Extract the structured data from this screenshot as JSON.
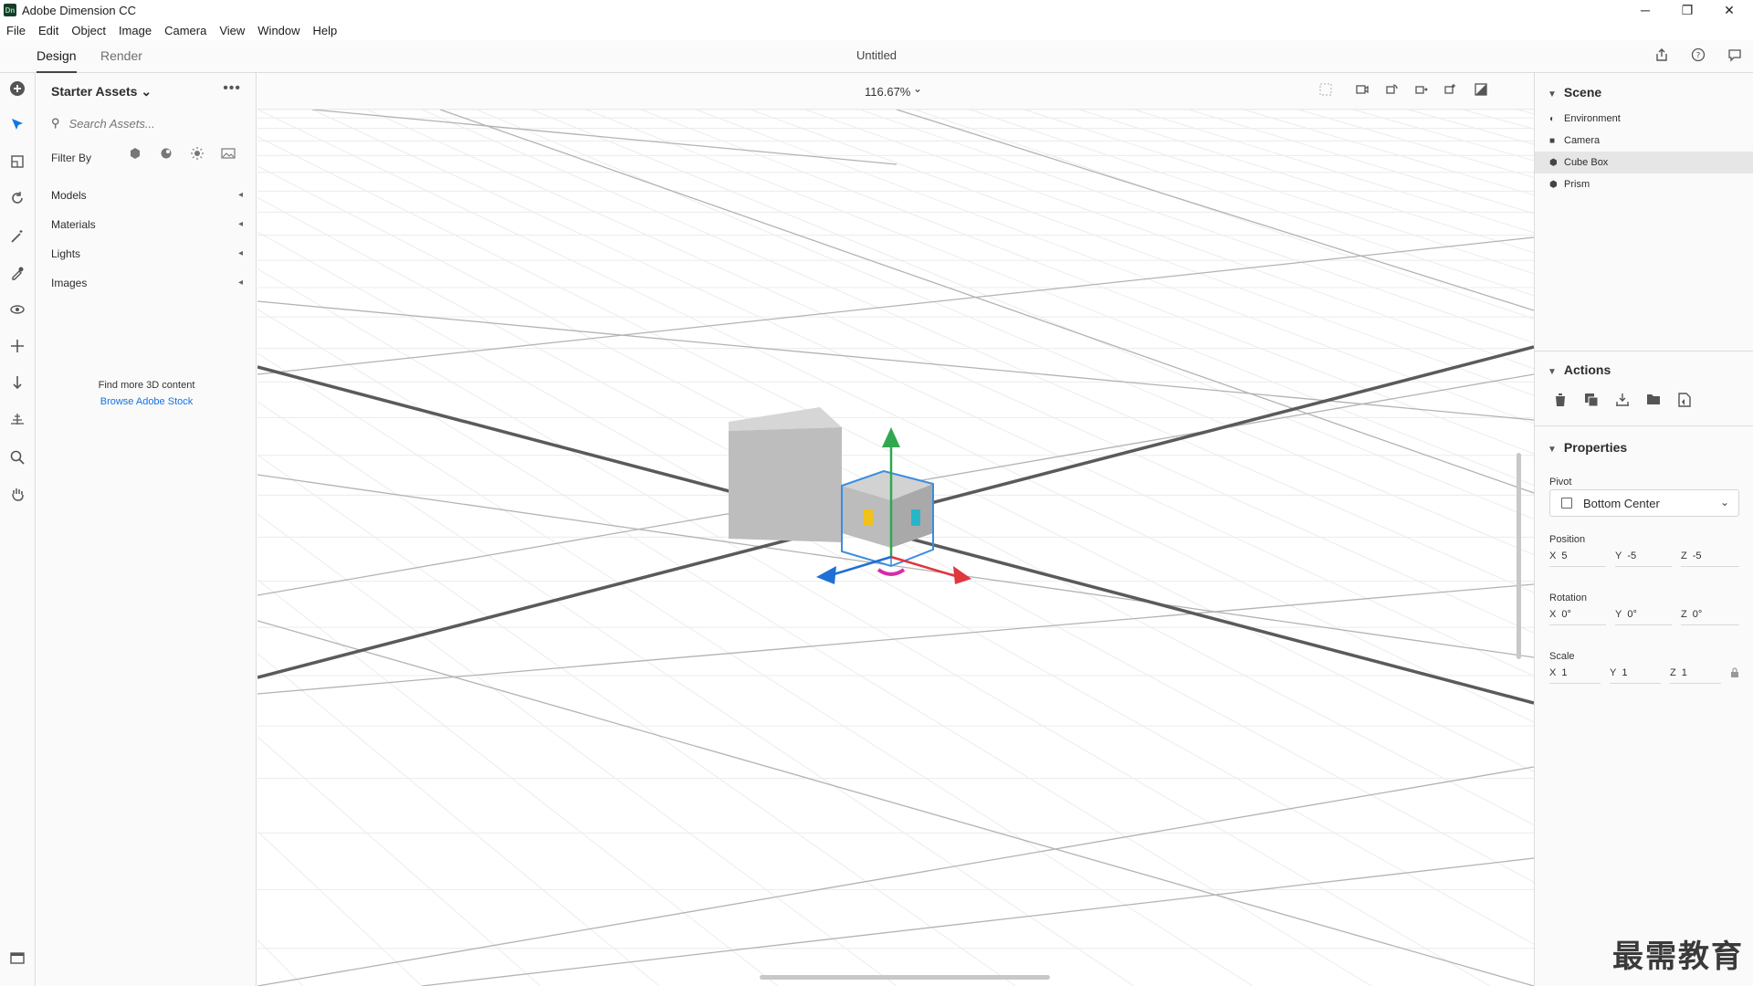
{
  "window": {
    "app_title": "Adobe Dimension CC",
    "logo_text": "Dn",
    "controls": {
      "minimize": "─",
      "restore": "❐",
      "close": "✕"
    }
  },
  "menubar": [
    "File",
    "Edit",
    "Object",
    "Image",
    "Camera",
    "View",
    "Window",
    "Help"
  ],
  "tabs": {
    "design": "Design",
    "render": "Render"
  },
  "document": {
    "title": "Untitled"
  },
  "assets": {
    "title": "Starter Assets",
    "title_caret": "⌄",
    "more": "•••",
    "search_icon": "⚲",
    "search_placeholder": "Search Assets...",
    "filter_label": "Filter By",
    "categories": [
      {
        "label": "Models",
        "caret": "◂"
      },
      {
        "label": "Materials",
        "caret": "◂"
      },
      {
        "label": "Lights",
        "caret": "◂"
      },
      {
        "label": "Images",
        "caret": "◂"
      }
    ],
    "find_more": "Find more 3D content",
    "browse_link": "Browse Adobe Stock"
  },
  "viewport": {
    "zoom": "116.67%",
    "zoom_caret": "⌄"
  },
  "scene": {
    "title": "Scene",
    "items": [
      {
        "label": "Environment",
        "icon": "environment-icon"
      },
      {
        "label": "Camera",
        "icon": "camera-icon"
      },
      {
        "label": "Cube Box",
        "icon": "model-icon",
        "selected": true
      },
      {
        "label": "Prism",
        "icon": "model-icon"
      }
    ]
  },
  "actions": {
    "title": "Actions"
  },
  "properties": {
    "title": "Properties",
    "pivot_label": "Pivot",
    "pivot_value": "Bottom Center",
    "position_label": "Position",
    "position": {
      "x": "5",
      "y": "-5",
      "z": "-5"
    },
    "rotation_label": "Rotation",
    "rotation": {
      "x": "0°",
      "y": "0°",
      "z": "0°"
    },
    "scale_label": "Scale",
    "scale": {
      "x": "1",
      "y": "1",
      "z": "1"
    },
    "axis": {
      "x": "X",
      "y": "Y",
      "z": "Z"
    }
  },
  "watermark": "最需教育",
  "colors": {
    "accent_link": "#1473e6",
    "gizmo_x": "#e0363e",
    "gizmo_y": "#2fa84f",
    "gizmo_z": "#1f6fd6",
    "selection": "#3a8de0"
  }
}
